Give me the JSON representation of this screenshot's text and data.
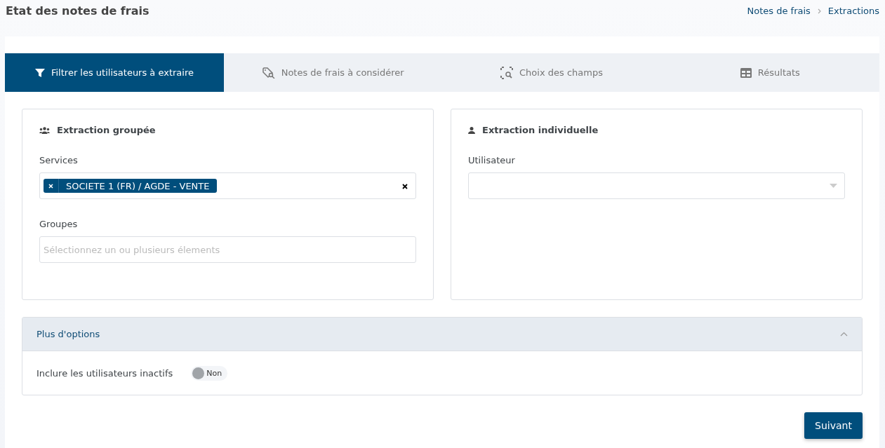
{
  "page_title": "Etat des notes de frais",
  "breadcrumbs": [
    "Notes de frais",
    "Extractions"
  ],
  "tabs": [
    {
      "label": "Filtrer les utilisateurs à extraire",
      "selected": true
    },
    {
      "label": "Notes de frais à considérer",
      "selected": false
    },
    {
      "label": "Choix des champs",
      "selected": false
    },
    {
      "label": "Résultats",
      "selected": false
    }
  ],
  "group_card": {
    "title": "Extraction groupée",
    "services": {
      "label": "Services",
      "tags": [
        "SOCIETE 1 (FR) / AGDE - VENTE"
      ]
    },
    "groups": {
      "label": "Groupes",
      "placeholder": "Sélectionnez un ou plusieurs élements"
    }
  },
  "individual_card": {
    "title": "Extraction individuelle",
    "user": {
      "label": "Utilisateur"
    }
  },
  "options": {
    "title": "Plus d'options",
    "expanded": true,
    "include_inactive": {
      "label": "Inclure les utilisateurs inactifs",
      "on": false,
      "state_text": "Non"
    }
  },
  "next_button": "Suivant"
}
